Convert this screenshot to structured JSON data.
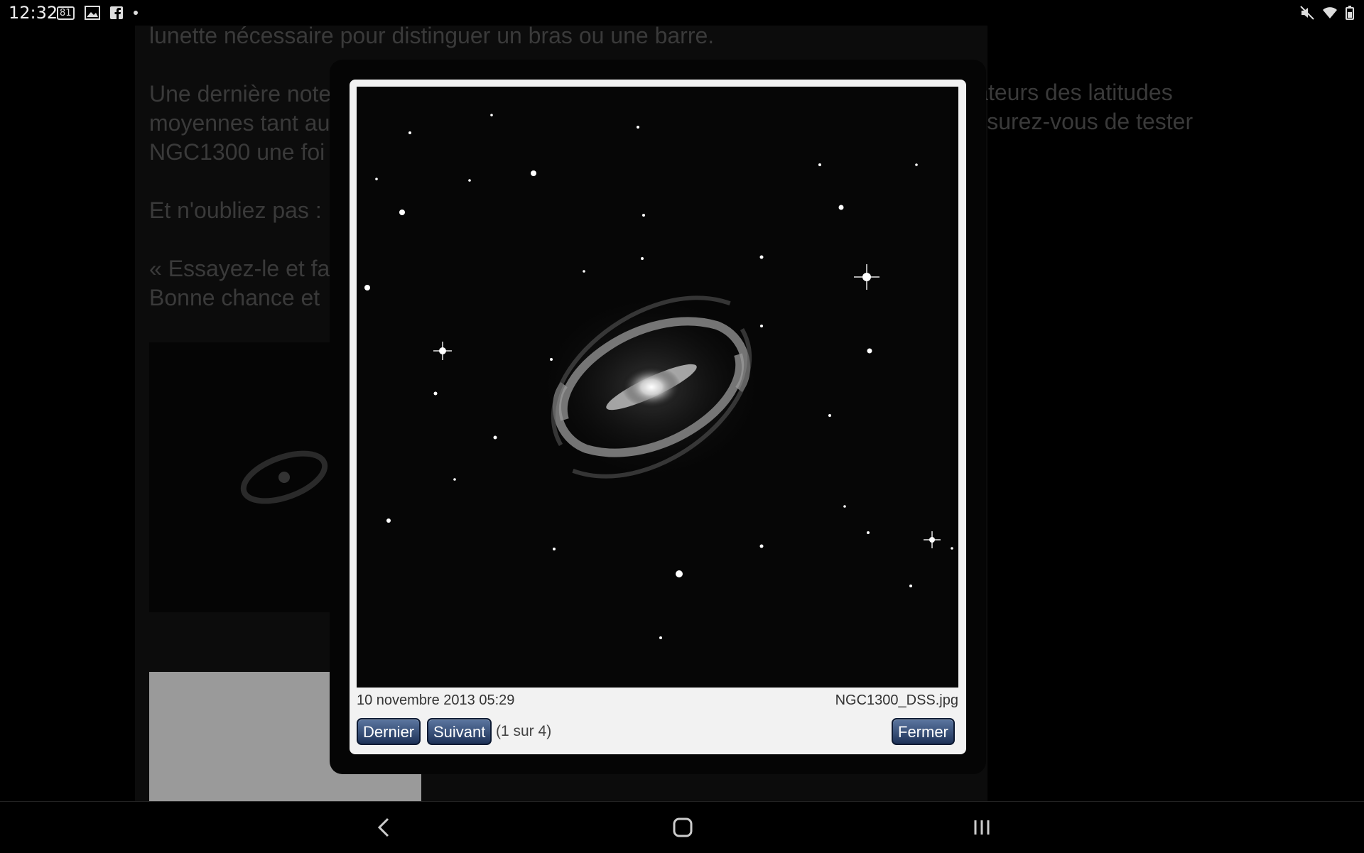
{
  "status_bar": {
    "time": "12:32",
    "badge": "81",
    "left_icons": [
      "gallery-icon",
      "facebook-icon",
      "dot-icon"
    ],
    "right_icons": [
      "mute-icon",
      "wifi-icon",
      "battery-icon"
    ]
  },
  "article": {
    "lines": [
      "lunette nécessaire pour distinguer un bras ou une barre.",
      "Une dernière note",
      "moyennes tant au",
      "NGC1300 une foi",
      "Et n'oubliez pas :",
      "« Essayez-le et fa",
      "Bonne chance et"
    ],
    "right_lines": [
      "ur les observateurs des latitudes",
      "ous sortez, assurez-vous de tester"
    ]
  },
  "lightbox": {
    "date": "10 novembre 2013 05:29",
    "filename": "NGC1300_DSS.jpg",
    "prev_label": "Dernier",
    "next_label": "Suivant",
    "counter": "(1 sur 4)",
    "close_label": "Fermer"
  },
  "nav_bar": {
    "icons": [
      "back-icon",
      "home-icon",
      "recents-icon"
    ]
  }
}
